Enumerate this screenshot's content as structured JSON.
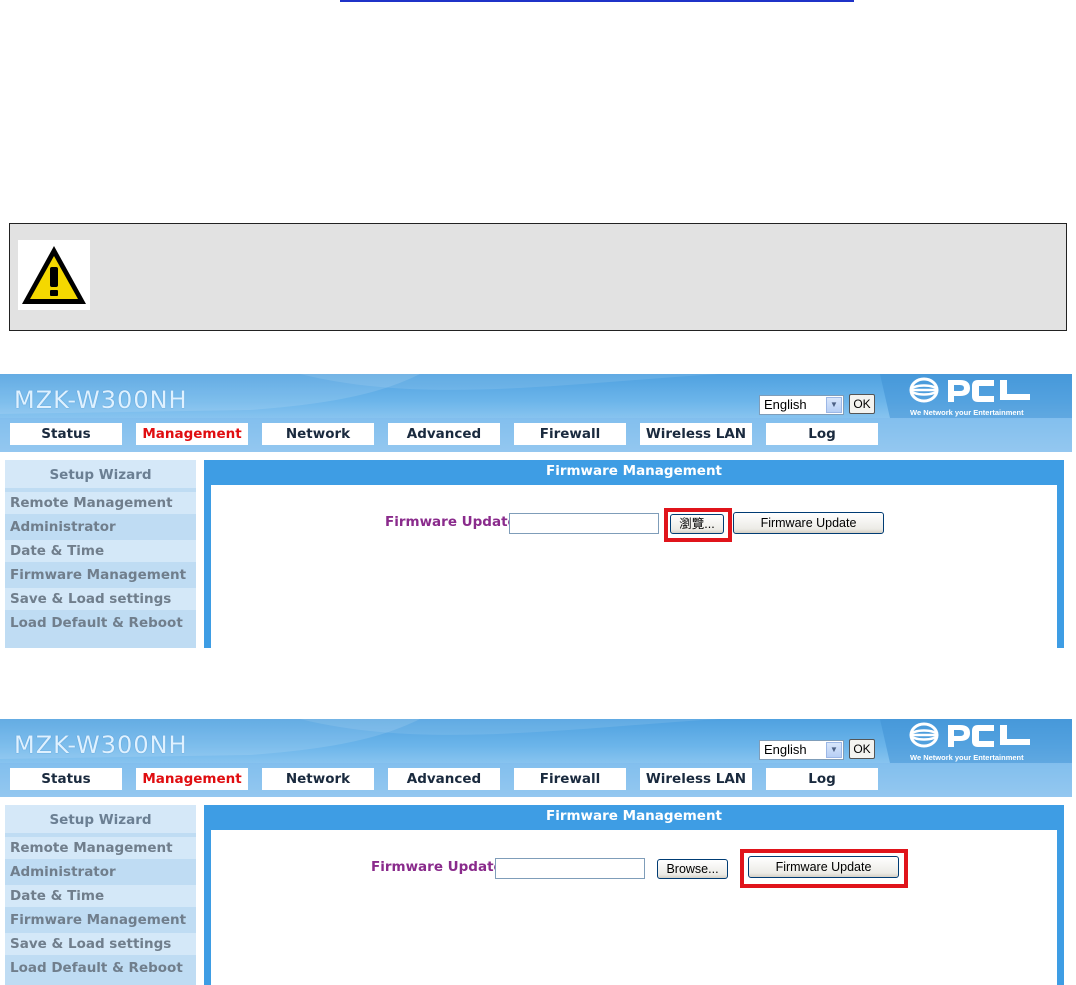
{
  "panels": [
    {
      "model_name": "MZK-W300NH",
      "language": "English",
      "ok_label": "OK",
      "logo_text": "PCI",
      "logo_tagline": "We Network your Entertainment",
      "nav": [
        "Status",
        "Management",
        "Network",
        "Advanced",
        "Firewall",
        "Wireless LAN",
        "Log"
      ],
      "nav_active": "Management",
      "sidebar_header": "Setup Wizard",
      "sidebar_items": [
        "Remote Management",
        "Administrator",
        "Date & Time",
        "Firmware Management",
        "Save & Load settings",
        "Load Default & Reboot"
      ],
      "content_title": "Firmware Management",
      "field_label": "Firmware Update",
      "field_value": "",
      "browse_label": "瀏覽...",
      "update_label": "Firmware Update",
      "highlighted": "browse-button"
    },
    {
      "model_name": "MZK-W300NH",
      "language": "English",
      "ok_label": "OK",
      "logo_text": "PCI",
      "logo_tagline": "We Network your Entertainment",
      "nav": [
        "Status",
        "Management",
        "Network",
        "Advanced",
        "Firewall",
        "Wireless LAN",
        "Log"
      ],
      "nav_active": "Management",
      "sidebar_header": "Setup Wizard",
      "sidebar_items": [
        "Remote Management",
        "Administrator",
        "Date & Time",
        "Firmware Management",
        "Save & Load settings",
        "Load Default & Reboot"
      ],
      "content_title": "Firmware Management",
      "field_label": "Firmware Update",
      "field_value": "",
      "browse_label": "Browse...",
      "update_label": "Firmware Update",
      "highlighted": "firmware-update-button"
    }
  ],
  "colors": {
    "active_tab": "#e00d10",
    "highlight": "#e0141b",
    "header_blue": "#4fa1e0",
    "field_label": "#8a2b8c",
    "warning_bg": "#e2e2e2"
  },
  "warning": {
    "icon": "warning-icon"
  }
}
